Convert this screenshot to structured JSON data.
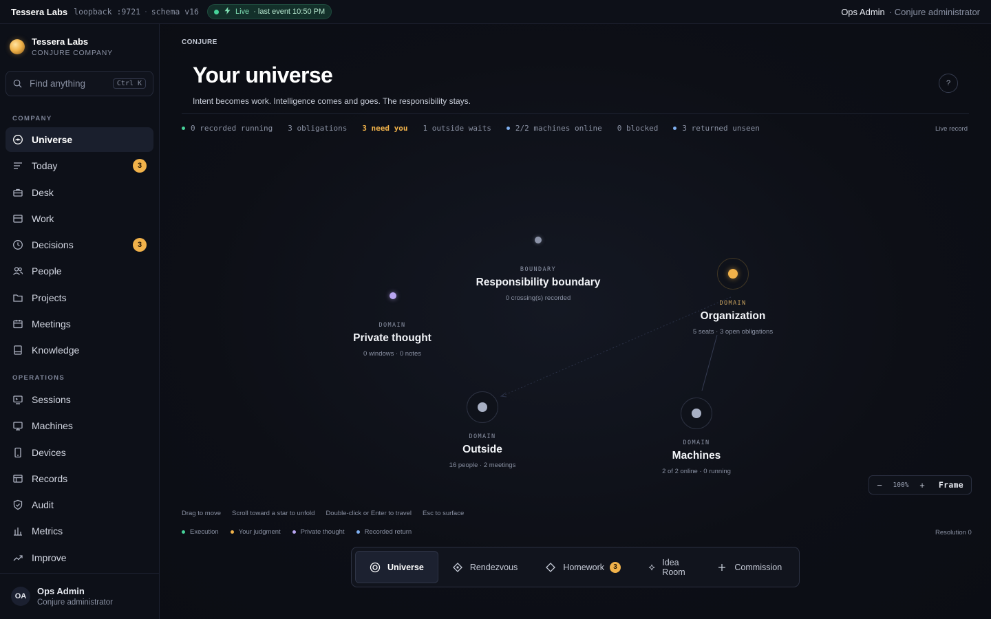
{
  "topbar": {
    "brand": "Tessera Labs",
    "host": "loopback :9721",
    "sep": "·",
    "schema": "schema v16",
    "live": "Live",
    "last_event": "· last event 10:50 PM",
    "user": "Ops Admin",
    "role": "· Conjure administrator"
  },
  "sidebar": {
    "org_name": "Tessera Labs",
    "org_sub": "CONJURE COMPANY",
    "search_placeholder": "Find anything",
    "search_shortcut": "Ctrl K",
    "company_label": "COMPANY",
    "company_items": [
      {
        "label": "Universe",
        "icon": "universe-icon"
      },
      {
        "label": "Today",
        "icon": "today-icon",
        "badge": "3"
      },
      {
        "label": "Desk",
        "icon": "desk-icon"
      },
      {
        "label": "Work",
        "icon": "work-icon"
      },
      {
        "label": "Decisions",
        "icon": "clock-icon",
        "badge": "3"
      },
      {
        "label": "People",
        "icon": "people-icon"
      },
      {
        "label": "Projects",
        "icon": "folder-icon"
      },
      {
        "label": "Meetings",
        "icon": "calendar-icon"
      },
      {
        "label": "Knowledge",
        "icon": "book-icon"
      }
    ],
    "operations_label": "OPERATIONS",
    "operations_items": [
      {
        "label": "Sessions",
        "icon": "sessions-icon"
      },
      {
        "label": "Machines",
        "icon": "monitor-icon"
      },
      {
        "label": "Devices",
        "icon": "device-icon"
      },
      {
        "label": "Records",
        "icon": "records-icon"
      },
      {
        "label": "Audit",
        "icon": "shield-icon"
      },
      {
        "label": "Metrics",
        "icon": "bar-chart-icon"
      },
      {
        "label": "Improve",
        "icon": "trend-icon"
      }
    ],
    "footer": {
      "initials": "OA",
      "name": "Ops Admin",
      "role": "Conjure administrator"
    }
  },
  "main": {
    "crumb": "CONJURE",
    "title": "Your universe",
    "subtitle": "Intent becomes work. Intelligence comes and goes. The responsibility stays.",
    "help": "?",
    "stats": [
      {
        "text": "0 recorded running",
        "dot": "#47d39a"
      },
      {
        "text": "3 obligations"
      },
      {
        "text": "3 need you",
        "hot": true
      },
      {
        "text": "1 outside waits"
      },
      {
        "text": "2/2 machines online",
        "dot": "#7fb0f0"
      },
      {
        "text": "0 blocked"
      },
      {
        "text": "3 returned unseen",
        "dot": "#7fb0f0"
      }
    ],
    "live_record": "Live record"
  },
  "universe": {
    "nodes": {
      "boundary": {
        "type": "BOUNDARY",
        "name": "Responsibility boundary",
        "info": "0 crossing(s) recorded"
      },
      "private": {
        "type": "DOMAIN",
        "name": "Private thought",
        "info": "0 windows · 0 notes"
      },
      "organization": {
        "type": "DOMAIN",
        "name": "Organization",
        "info": "5 seats · 3 open obligations"
      },
      "outside": {
        "type": "DOMAIN",
        "name": "Outside",
        "info": "16 people · 2 meetings"
      },
      "machines": {
        "type": "DOMAIN",
        "name": "Machines",
        "info": "2 of 2 online · 0 running"
      }
    },
    "colors": {
      "boundary": "#8c93a8",
      "private": "#b9a6f2",
      "organization": "#f1b24a",
      "outside": "#9aa3b8",
      "machines": "#9aa3b8"
    }
  },
  "zoom": {
    "minus": "−",
    "value": "100%",
    "plus": "+",
    "frame": "Frame"
  },
  "hints": [
    "Drag to move",
    "Scroll toward a star to unfold",
    "Double-click or Enter to travel",
    "Esc to surface"
  ],
  "legend": [
    {
      "label": "Execution",
      "color": "#47d39a"
    },
    {
      "label": "Your judgment",
      "color": "#f1b24a"
    },
    {
      "label": "Private thought",
      "color": "#b9a6f2"
    },
    {
      "label": "Recorded return",
      "color": "#7fb0f0"
    }
  ],
  "resolution": "Resolution 0",
  "dock": [
    {
      "label": "Universe",
      "icon": "target-icon",
      "active": true
    },
    {
      "label": "Rendezvous",
      "icon": "diamond-dot-icon"
    },
    {
      "label": "Homework",
      "icon": "diamond-icon",
      "badge": "3"
    },
    {
      "label": "Idea Room",
      "icon": "sparkle-icon"
    },
    {
      "label": "Commission",
      "icon": "plus-icon"
    }
  ]
}
